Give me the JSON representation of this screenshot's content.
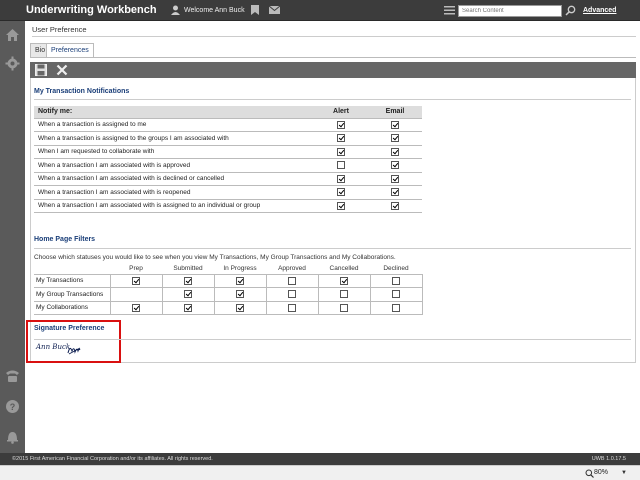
{
  "header": {
    "app_title": "Underwriting Workbench",
    "welcome": "Welcome Ann Buck",
    "search_placeholder": "Search Content",
    "advanced_label": "Advanced"
  },
  "page": {
    "title": "User Preference",
    "tabs": [
      {
        "label": "Bio",
        "active": false
      },
      {
        "label": "Preferences",
        "active": true
      }
    ]
  },
  "notifications": {
    "title": "My Transaction Notifications",
    "headers": {
      "label": "Notify me:",
      "alert": "Alert",
      "email": "Email"
    },
    "rows": [
      {
        "label": "When a transaction is assigned to me",
        "alert": true,
        "email": true
      },
      {
        "label": "When a transaction is assigned to the groups I am associated with",
        "alert": true,
        "email": true
      },
      {
        "label": "When I am requested to collaborate with",
        "alert": true,
        "email": true
      },
      {
        "label": "When a transaction I am associated with is approved",
        "alert": false,
        "email": true
      },
      {
        "label": "When a transaction I am associated with is declined or cancelled",
        "alert": true,
        "email": true
      },
      {
        "label": "When a transaction I am associated with is reopened",
        "alert": true,
        "email": true
      },
      {
        "label": "When a transaction I am associated with is assigned to an individual or group",
        "alert": true,
        "email": true
      }
    ]
  },
  "filters": {
    "title": "Home Page Filters",
    "description": "Choose which statuses you would like to see when you view My Transactions, My Group Transactions and My Collaborations.",
    "columns": [
      "Prep",
      "Submitted",
      "In Progress",
      "Approved",
      "Cancelled",
      "Declined"
    ],
    "rows": [
      {
        "label": "My Transactions",
        "values": [
          true,
          true,
          true,
          false,
          true,
          false
        ]
      },
      {
        "label": "My Group Transactions",
        "values": [
          null,
          true,
          true,
          false,
          false,
          false
        ]
      },
      {
        "label": "My Collaborations",
        "values": [
          true,
          true,
          true,
          false,
          false,
          false
        ]
      }
    ]
  },
  "signature": {
    "title": "Signature Preference",
    "text": "Ann Buck"
  },
  "footer": {
    "copyright": "©2015 First American Financial Corporation and/or its affiliates. All rights reserved.",
    "version": "UWB 1.0.17.5"
  },
  "statusbar": {
    "zoom": "80%"
  },
  "colors": {
    "topbar": "#3c3c3c",
    "accent": "#1a3e78",
    "highlight": "#d91010"
  }
}
